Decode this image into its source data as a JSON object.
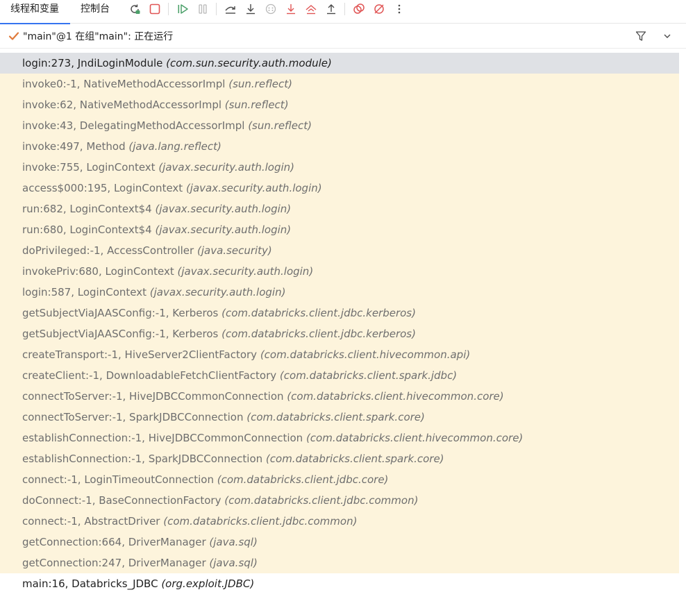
{
  "tabs": [
    {
      "label": "线程和变量",
      "active": true
    },
    {
      "label": "控制台",
      "active": false
    }
  ],
  "toolbar_icons": [
    "rerun-icon",
    "stop-icon",
    "resume-icon",
    "pause-icon",
    "step-over-icon",
    "step-into-icon",
    "force-step-into-icon",
    "smart-step-icon",
    "step-out-icon",
    "view-breakpoints-icon",
    "mute-breakpoints-icon",
    "more-icon"
  ],
  "colors": {
    "accent": "#3574f0",
    "stop": "#e05555",
    "resume": "#4ca06a",
    "step": "#4a4a4a",
    "step_red": "#e05555",
    "check": "#e07a3b",
    "library_frame_bg": "#fdf4dc",
    "selected_frame_bg": "#dfe1e5"
  },
  "thread": {
    "status_icon": "check-icon",
    "label": "\"main\"@1 在组\"main\": 正在运行"
  },
  "frames": [
    {
      "method": "login:273, JndiLoginModule ",
      "pkg": "(com.sun.security.auth.module)",
      "state": "selected"
    },
    {
      "method": "invoke0:-1, NativeMethodAccessorImpl ",
      "pkg": "(sun.reflect)",
      "state": "library"
    },
    {
      "method": "invoke:62, NativeMethodAccessorImpl ",
      "pkg": "(sun.reflect)",
      "state": "library"
    },
    {
      "method": "invoke:43, DelegatingMethodAccessorImpl ",
      "pkg": "(sun.reflect)",
      "state": "library"
    },
    {
      "method": "invoke:497, Method ",
      "pkg": "(java.lang.reflect)",
      "state": "library"
    },
    {
      "method": "invoke:755, LoginContext ",
      "pkg": "(javax.security.auth.login)",
      "state": "library"
    },
    {
      "method": "access$000:195, LoginContext ",
      "pkg": "(javax.security.auth.login)",
      "state": "library"
    },
    {
      "method": "run:682, LoginContext$4 ",
      "pkg": "(javax.security.auth.login)",
      "state": "library"
    },
    {
      "method": "run:680, LoginContext$4 ",
      "pkg": "(javax.security.auth.login)",
      "state": "library"
    },
    {
      "method": "doPrivileged:-1, AccessController ",
      "pkg": "(java.security)",
      "state": "library"
    },
    {
      "method": "invokePriv:680, LoginContext ",
      "pkg": "(javax.security.auth.login)",
      "state": "library"
    },
    {
      "method": "login:587, LoginContext ",
      "pkg": "(javax.security.auth.login)",
      "state": "library"
    },
    {
      "method": "getSubjectViaJAASConfig:-1, Kerberos ",
      "pkg": "(com.databricks.client.jdbc.kerberos)",
      "state": "library"
    },
    {
      "method": "getSubjectViaJAASConfig:-1, Kerberos ",
      "pkg": "(com.databricks.client.jdbc.kerberos)",
      "state": "library"
    },
    {
      "method": "createTransport:-1, HiveServer2ClientFactory ",
      "pkg": "(com.databricks.client.hivecommon.api)",
      "state": "library"
    },
    {
      "method": "createClient:-1, DownloadableFetchClientFactory ",
      "pkg": "(com.databricks.client.spark.jdbc)",
      "state": "library"
    },
    {
      "method": "connectToServer:-1, HiveJDBCCommonConnection ",
      "pkg": "(com.databricks.client.hivecommon.core)",
      "state": "library"
    },
    {
      "method": "connectToServer:-1, SparkJDBCConnection ",
      "pkg": "(com.databricks.client.spark.core)",
      "state": "library"
    },
    {
      "method": "establishConnection:-1, HiveJDBCCommonConnection ",
      "pkg": "(com.databricks.client.hivecommon.core)",
      "state": "library"
    },
    {
      "method": "establishConnection:-1, SparkJDBCConnection ",
      "pkg": "(com.databricks.client.spark.core)",
      "state": "library"
    },
    {
      "method": "connect:-1, LoginTimeoutConnection ",
      "pkg": "(com.databricks.client.jdbc.core)",
      "state": "library"
    },
    {
      "method": "doConnect:-1, BaseConnectionFactory ",
      "pkg": "(com.databricks.client.jdbc.common)",
      "state": "library"
    },
    {
      "method": "connect:-1, AbstractDriver ",
      "pkg": "(com.databricks.client.jdbc.common)",
      "state": "library"
    },
    {
      "method": "getConnection:664, DriverManager ",
      "pkg": "(java.sql)",
      "state": "library"
    },
    {
      "method": "getConnection:247, DriverManager ",
      "pkg": "(java.sql)",
      "state": "library"
    },
    {
      "method": "main:16, Databricks_JDBC ",
      "pkg": "(org.exploit.JDBC)",
      "state": "normal"
    }
  ]
}
